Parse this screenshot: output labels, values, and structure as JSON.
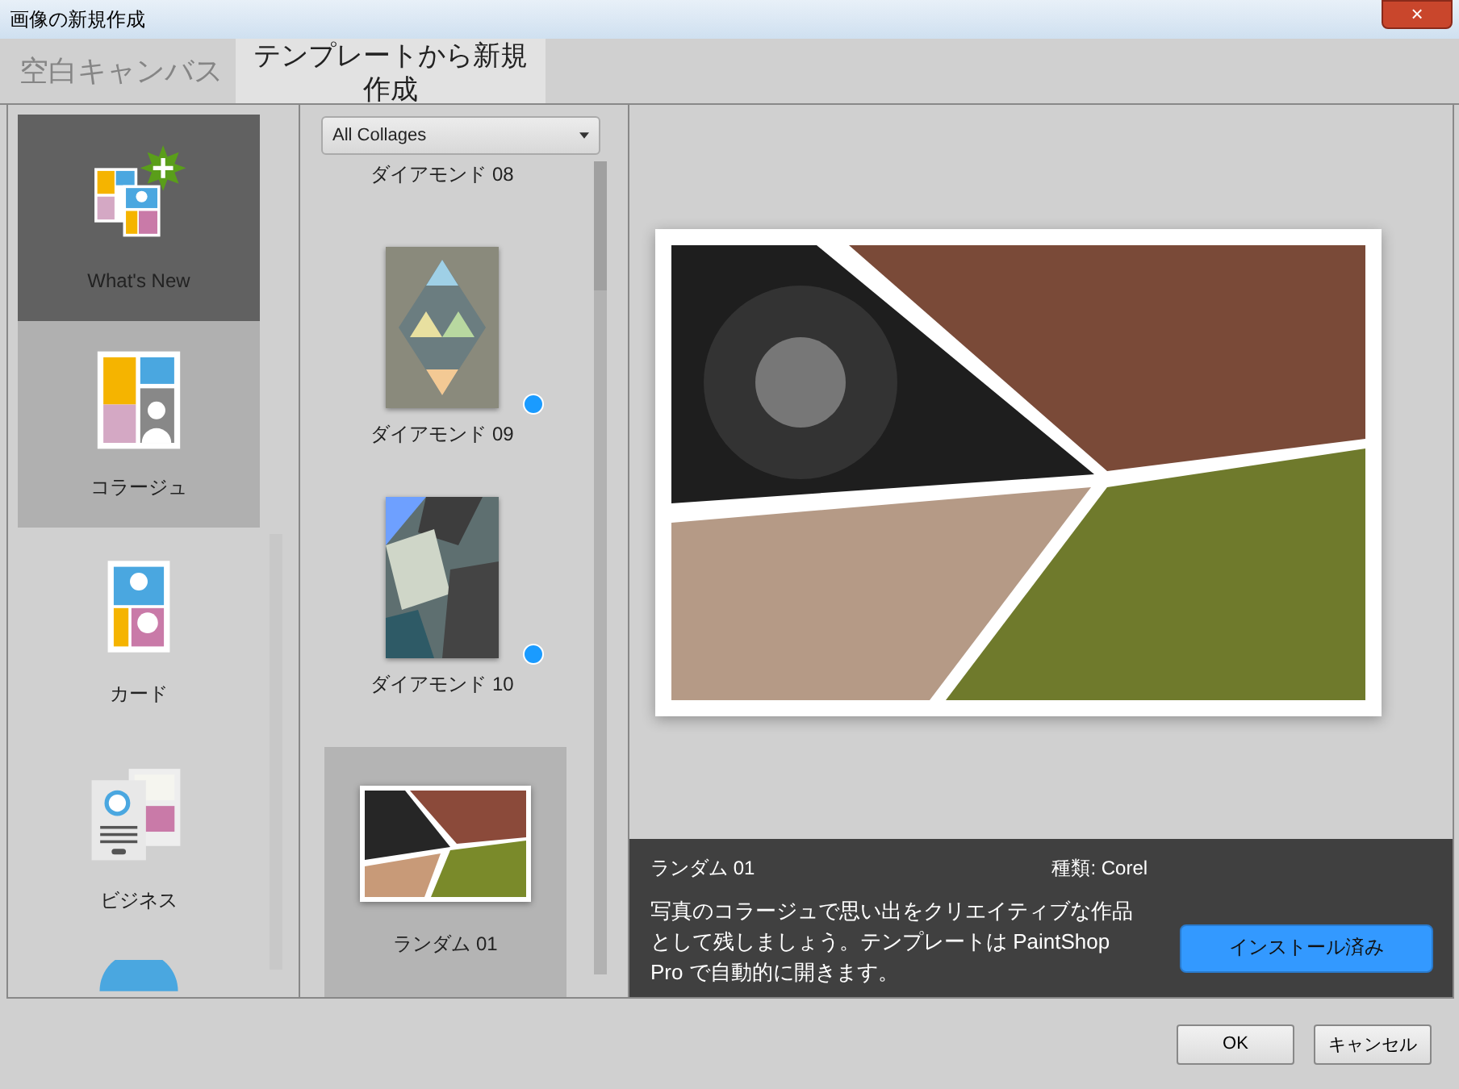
{
  "window": {
    "title": "画像の新規作成",
    "close": "×"
  },
  "tabs": [
    {
      "label": "空白キャンバス",
      "selected": false
    },
    {
      "label": "テンプレートから新規作成",
      "selected": true
    }
  ],
  "categories": [
    {
      "kind": "new",
      "label": "What's New",
      "selected": false
    },
    {
      "kind": "collage",
      "label": "コラージュ",
      "selected": true
    },
    {
      "kind": "card",
      "label": "カード",
      "selected": false
    },
    {
      "kind": "business",
      "label": "ビジネス",
      "selected": false
    },
    {
      "kind": "round",
      "selected": false
    }
  ],
  "filter": {
    "value": "All Collages"
  },
  "templates": [
    {
      "kind": "none",
      "label": "ダイアモンド 08",
      "selected": false,
      "marked": false
    },
    {
      "kind": "diamond",
      "label": "ダイアモンド 09",
      "selected": false,
      "marked": true
    },
    {
      "kind": "shards",
      "label": "ダイアモンド 10",
      "selected": false,
      "marked": true
    },
    {
      "kind": "wide",
      "label": "ランダム 01",
      "selected": true,
      "marked": false
    }
  ],
  "details": {
    "name": "ランダム 01",
    "type": "種類: Corel",
    "description": "写真のコラージュで思い出をクリエイティブな作品として残しましょう。テンプレートは PaintShop Pro で自動的に開きます。",
    "action": "インストール済み"
  },
  "buttons": [
    "OK",
    "キャンセル"
  ]
}
